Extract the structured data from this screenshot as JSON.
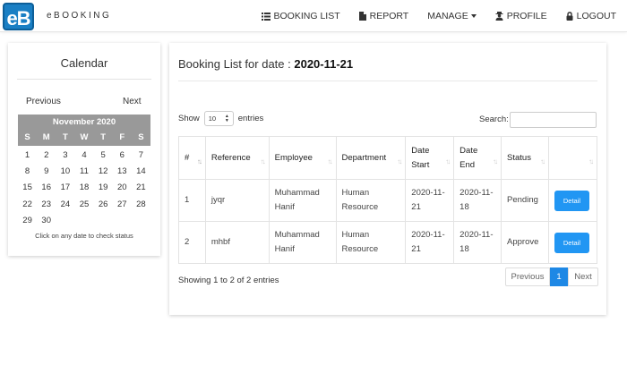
{
  "brand": {
    "logo_text": "eB",
    "name": "eBOOKING"
  },
  "nav": {
    "booking_list": "BOOKING LIST",
    "report": "REPORT",
    "manage": "MANAGE",
    "profile": "PROFILE",
    "logout": "LOGOUT"
  },
  "calendar": {
    "title": "Calendar",
    "prev": "Previous",
    "next": "Next",
    "month": "November 2020",
    "dow": [
      "S",
      "M",
      "T",
      "W",
      "T",
      "F",
      "S"
    ],
    "weeks": [
      [
        "1",
        "2",
        "3",
        "4",
        "5",
        "6",
        "7"
      ],
      [
        "8",
        "9",
        "10",
        "11",
        "12",
        "13",
        "14"
      ],
      [
        "15",
        "16",
        "17",
        "18",
        "19",
        "20",
        "21"
      ],
      [
        "22",
        "23",
        "24",
        "25",
        "26",
        "27",
        "28"
      ],
      [
        "29",
        "30",
        "",
        "",
        "",
        "",
        ""
      ]
    ],
    "hint": "Click on any date to check status"
  },
  "booking": {
    "title_prefix": "Booking List for date : ",
    "date": "2020-11-21",
    "show_label": "Show",
    "page_size": "10",
    "entries_label": "entries",
    "search_label": "Search:",
    "headers": [
      "#",
      "Reference",
      "Employee",
      "Department",
      "Date Start",
      "Date End",
      "Status",
      ""
    ],
    "rows": [
      {
        "num": "1",
        "ref": "jyqr",
        "employee": "Muhammad Hanif",
        "department": "Human Resource",
        "start": "2020-11-21",
        "end": "2020-11-18",
        "status": "Pending",
        "action": "Detail"
      },
      {
        "num": "2",
        "ref": "mhbf",
        "employee": "Muhammad Hanif",
        "department": "Human Resource",
        "start": "2020-11-21",
        "end": "2020-11-18",
        "status": "Approve",
        "action": "Detail"
      }
    ],
    "info": "Showing 1 to 2 of 2 entries",
    "pager": {
      "prev": "Previous",
      "page": "1",
      "next": "Next"
    }
  },
  "colors": {
    "primary": "#2196f3",
    "pending": "#e0a800",
    "approve": "#28a745",
    "calendar_header": "#999999"
  }
}
